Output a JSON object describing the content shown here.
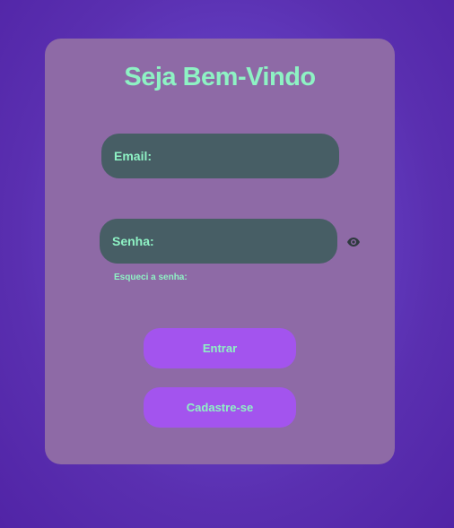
{
  "login": {
    "title": "Seja Bem-Vindo",
    "email": {
      "value": "",
      "placeholder": "Email:"
    },
    "password": {
      "value": "",
      "placeholder": "Senha:"
    },
    "toggle_password_icon": "eye-icon",
    "forgot_password_label": "Esqueci a senha:",
    "login_button_label": "Entrar",
    "signup_button_label": "Cadastre-se"
  },
  "colors": {
    "background": "#5a2fb0",
    "card": "#8e6aa6",
    "input": "#475e65",
    "button": "#a354ee",
    "text_accent": "#8ef2c4",
    "icon": "#2f3a3f"
  }
}
